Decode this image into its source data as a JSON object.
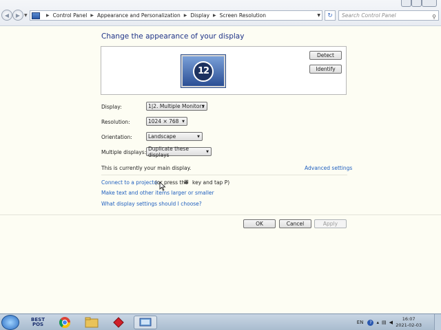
{
  "address_bar": {
    "breadcrumbs": [
      "Control Panel",
      "Appearance and Personalization",
      "Display",
      "Screen Resolution"
    ],
    "search_placeholder": "Search Control Panel"
  },
  "main": {
    "title": "Change the appearance of your display",
    "monitor_number": "12",
    "detect_label": "Detect",
    "identify_label": "Identify",
    "display_label": "Display:",
    "display_value": "1|2. Multiple Monitors",
    "resolution_label": "Resolution:",
    "resolution_value": "1024 × 768",
    "orientation_label": "Orientation:",
    "orientation_value": "Landscape",
    "multiple_label": "Multiple displays:",
    "multiple_value": "Duplicate these displays",
    "main_display_text": "This is currently your main display.",
    "advanced_link": "Advanced settings",
    "projector_link": "Connect to a projector",
    "projector_hint_pre": "(or press the",
    "projector_hint_post": "key and tap P)",
    "text_size_link": "Make text and other items larger or smaller",
    "choose_link": "What display settings should I choose?",
    "ok_label": "OK",
    "cancel_label": "Cancel",
    "apply_label": "Apply"
  },
  "taskbar": {
    "pos_label_top": "BEST",
    "pos_label_bottom": "POS",
    "language": "EN",
    "time": "16:07",
    "date": "2021-02-03"
  }
}
